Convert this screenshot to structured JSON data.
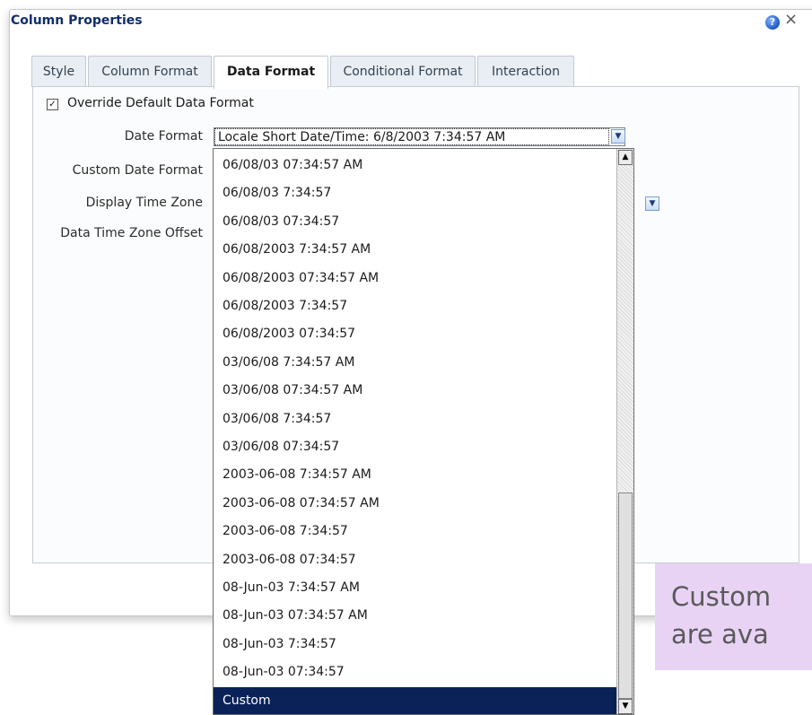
{
  "dialog": {
    "title": "Column Properties",
    "help_glyph": "?",
    "close_glyph": "×"
  },
  "tabs": [
    {
      "label": "Style",
      "active": false
    },
    {
      "label": "Column Format",
      "active": false
    },
    {
      "label": "Data Format",
      "active": true
    },
    {
      "label": "Conditional Format",
      "active": false
    },
    {
      "label": "Interaction",
      "active": false
    }
  ],
  "override": {
    "checked": true,
    "check_glyph": "✓",
    "label": "Override Default Data Format"
  },
  "fields": {
    "date_format_label": "Date Format",
    "date_format_value": "Locale Short Date/Time: 6/8/2003 7:34:57 AM",
    "custom_date_format_label": "Custom Date Format",
    "display_time_zone_label": "Display Time Zone",
    "data_time_zone_offset_label": "Data Time Zone Offset"
  },
  "dropdown": {
    "items": [
      "06/08/03 07:34:57 AM",
      "06/08/03 7:34:57",
      "06/08/03 07:34:57",
      "06/08/2003 7:34:57 AM",
      "06/08/2003 07:34:57 AM",
      "06/08/2003 7:34:57",
      "06/08/2003 07:34:57",
      "03/06/08 7:34:57 AM",
      "03/06/08 07:34:57 AM",
      "03/06/08 7:34:57",
      "03/06/08 07:34:57",
      "2003-06-08 7:34:57 AM",
      "2003-06-08 07:34:57 AM",
      "2003-06-08 7:34:57",
      "2003-06-08 07:34:57",
      "08-Jun-03 7:34:57 AM",
      "08-Jun-03 07:34:57 AM",
      "08-Jun-03 7:34:57",
      "08-Jun-03 07:34:57",
      "Custom"
    ],
    "selected_index": 19,
    "scroll_up_glyph": "▲",
    "scroll_down_glyph": "▼"
  },
  "dropdown_glyph": "▼",
  "callout": {
    "line1": "Custom",
    "line2": "are ava"
  },
  "colors": {
    "title": "#0f2e6b",
    "selection": "#0a2258",
    "callout_bg": "#e9d3f5"
  }
}
